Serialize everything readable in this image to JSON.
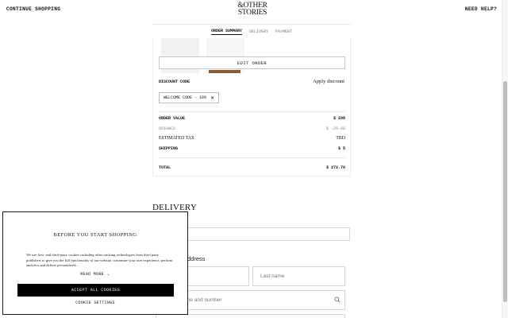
{
  "header": {
    "continue_label": "CONTINUE SHOPPING",
    "help_label": "NEED HELP?",
    "logo_line1": "&OTHER",
    "logo_line2": "STORIES"
  },
  "steps": [
    "ORDER SUMMARY",
    "DELIVERY",
    "PAYMENT"
  ],
  "active_step": "ORDER SUMMARY",
  "summary": {
    "edit_order_label": "EDIT ORDER",
    "discount_label": "DISCOUNT CODE",
    "apply_discount_label": "Apply discount",
    "applied_code": "WELCOME CODE - 10%",
    "rows": [
      {
        "label": "ORDER VALUE",
        "value": "$ 298"
      },
      {
        "label": "OS10WCS",
        "value": "$ -29.80"
      },
      {
        "label": "ESTIMATED TAX",
        "value": "TBD"
      },
      {
        "label": "SHIPPING",
        "value": "$ 5"
      },
      {
        "label": "TOTAL",
        "value": "$ 272.70"
      }
    ]
  },
  "delivery": {
    "title": "DELIVERY",
    "field1_partial": "s",
    "address_title_partial": "ddress",
    "first_name_partial": "e",
    "last_name_placeholder": "Last name",
    "street_partial": "me and number"
  },
  "cookie": {
    "title": "BEFORE YOU START SHOPPING",
    "body": "We use first- and third-party cookies including other tracking technologies from third party publishers to give you the full functionality of our website, customize your user experience, perform analytics and deliver personalized...",
    "read_more_label": "READ MORE",
    "accept_label": "ACCEPT ALL COOKIES",
    "settings_label": "COOKIE SETTINGS"
  },
  "colors": {
    "accent": "#000000",
    "product_band": "#8a5a36"
  }
}
